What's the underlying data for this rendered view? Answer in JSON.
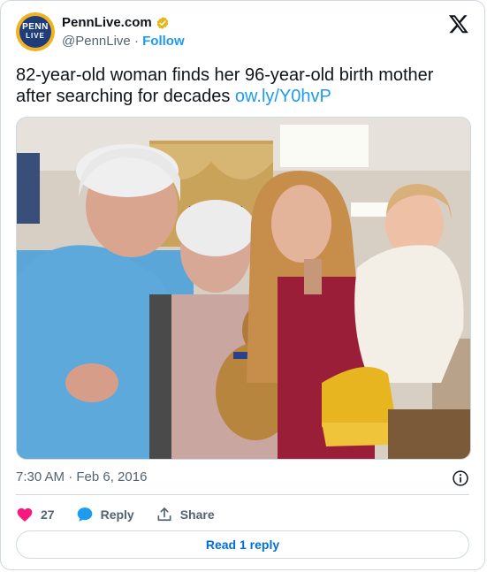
{
  "author": {
    "display_name": "PennLive.com",
    "handle": "@PennLive",
    "separator": "·",
    "follow_label": "Follow",
    "avatar_text_line1": "PENN",
    "avatar_text_line2": "LIVE"
  },
  "tweet": {
    "text": "82-year-old woman finds her 96-year-old birth mother after searching for decades ",
    "link_text": "ow.ly/Y0hvP",
    "timestamp": "7:30 AM · Feb 6, 2016"
  },
  "actions": {
    "like_count": "27",
    "reply_label": "Reply",
    "share_label": "Share",
    "read_replies_label": "Read 1 reply"
  },
  "colors": {
    "link": "#1d9bf0",
    "like": "#f91880",
    "verified_badge": "#e2b719",
    "read_reply_text": "#006fd6"
  },
  "icons": [
    "verified-badge-icon",
    "x-logo-icon",
    "info-icon",
    "heart-icon",
    "reply-bubble-icon",
    "share-icon"
  ]
}
